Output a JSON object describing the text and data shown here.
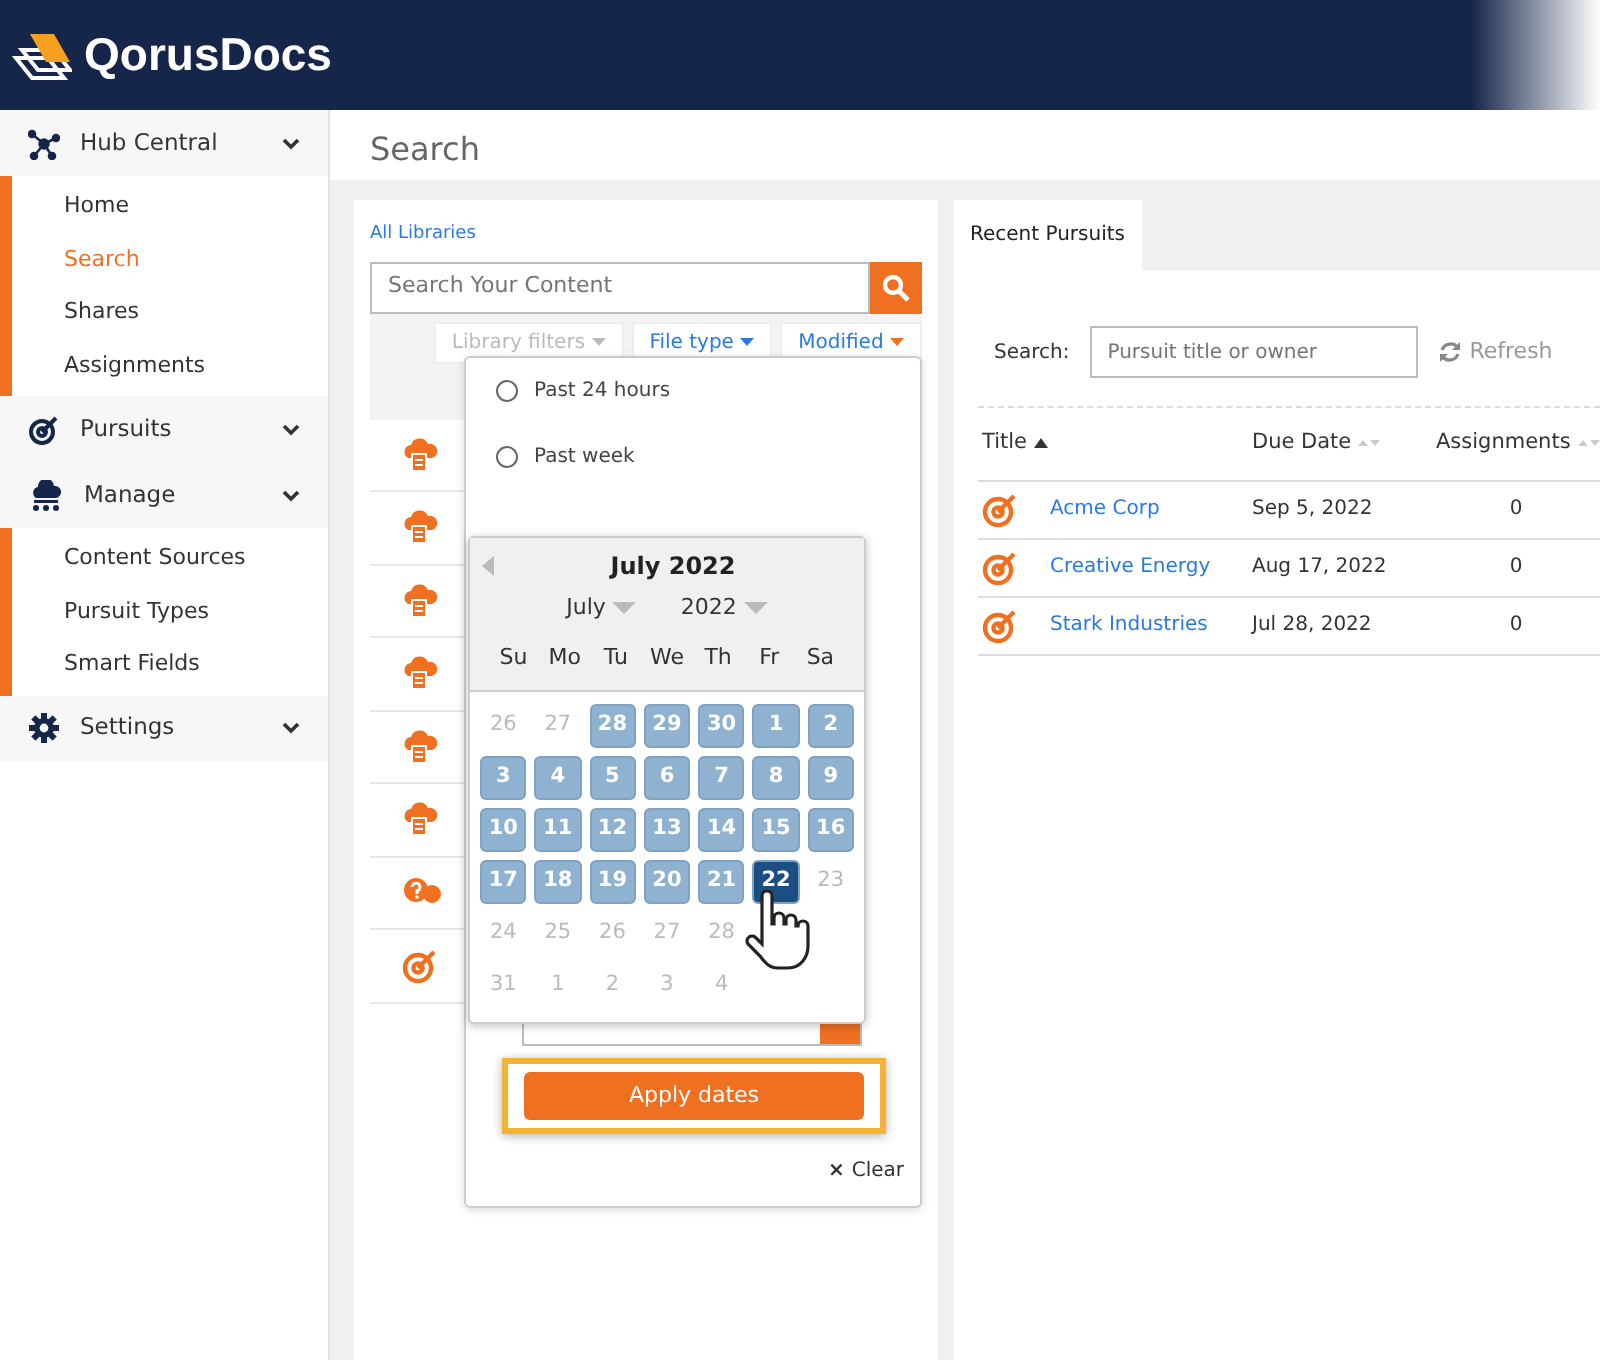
{
  "brand": {
    "name": "QorusDocs"
  },
  "sidebar": {
    "groups": [
      {
        "label": "Hub Central",
        "children": [
          {
            "label": "Home",
            "selected": false
          },
          {
            "label": "Search",
            "selected": true
          },
          {
            "label": "Shares",
            "selected": false
          },
          {
            "label": "Assignments",
            "selected": false
          }
        ]
      },
      {
        "label": "Pursuits"
      },
      {
        "label": "Manage",
        "children": [
          {
            "label": "Content Sources",
            "selected": false
          },
          {
            "label": "Pursuit Types",
            "selected": false
          },
          {
            "label": "Smart Fields",
            "selected": false
          }
        ]
      },
      {
        "label": "Settings"
      }
    ]
  },
  "page_title": "Search",
  "search_panel": {
    "library_link": "All Libraries",
    "search": {
      "placeholder": "Search Your Content"
    },
    "filters": [
      {
        "label": "Library filters",
        "disabled": true,
        "selected": false
      },
      {
        "label": "File type",
        "disabled": false,
        "selected": false
      },
      {
        "label": "Modified",
        "disabled": false,
        "selected": true
      }
    ],
    "results": [
      {
        "kind": "cloud"
      },
      {
        "kind": "cloud"
      },
      {
        "kind": "cloud"
      },
      {
        "kind": "cloud"
      },
      {
        "kind": "cloud"
      },
      {
        "kind": "cloud"
      },
      {
        "kind": "chat"
      },
      {
        "kind": "target"
      }
    ],
    "date_menu": {
      "options": [
        {
          "label": "Past 24 hours",
          "selected": false
        },
        {
          "label": "Past week",
          "selected": false
        }
      ],
      "apply_button": "Apply dates",
      "clear_button": "Clear",
      "clear_icon": "×"
    },
    "calendar": {
      "title": "July 2022",
      "month": "July",
      "year": "2022",
      "weekdays": [
        "Su",
        "Mo",
        "Tu",
        "We",
        "Th",
        "Fr",
        "Sa"
      ],
      "weeks": [
        [
          {
            "day": "26",
            "kind": "other",
            "selected": false
          },
          {
            "day": "27",
            "kind": "other",
            "selected": false
          },
          {
            "day": "28",
            "kind": "range",
            "selected": false
          },
          {
            "day": "29",
            "kind": "range",
            "selected": false
          },
          {
            "day": "30",
            "kind": "range",
            "selected": false
          },
          {
            "day": "1",
            "kind": "range",
            "selected": false
          },
          {
            "day": "2",
            "kind": "range",
            "selected": false
          }
        ],
        [
          {
            "day": "3",
            "kind": "range",
            "selected": false
          },
          {
            "day": "4",
            "kind": "range",
            "selected": false
          },
          {
            "day": "5",
            "kind": "range",
            "selected": false
          },
          {
            "day": "6",
            "kind": "range",
            "selected": false
          },
          {
            "day": "7",
            "kind": "range",
            "selected": false
          },
          {
            "day": "8",
            "kind": "range",
            "selected": false
          },
          {
            "day": "9",
            "kind": "range",
            "selected": false
          }
        ],
        [
          {
            "day": "10",
            "kind": "range",
            "selected": false
          },
          {
            "day": "11",
            "kind": "range",
            "selected": false
          },
          {
            "day": "12",
            "kind": "range",
            "selected": false
          },
          {
            "day": "13",
            "kind": "range",
            "selected": false
          },
          {
            "day": "14",
            "kind": "range",
            "selected": false
          },
          {
            "day": "15",
            "kind": "range",
            "selected": false
          },
          {
            "day": "16",
            "kind": "range",
            "selected": false
          }
        ],
        [
          {
            "day": "17",
            "kind": "range",
            "selected": false
          },
          {
            "day": "18",
            "kind": "range",
            "selected": false
          },
          {
            "day": "19",
            "kind": "range",
            "selected": false
          },
          {
            "day": "20",
            "kind": "range",
            "selected": false
          },
          {
            "day": "21",
            "kind": "range",
            "selected": false
          },
          {
            "day": "22",
            "kind": "range",
            "selected": true
          },
          {
            "day": "23",
            "kind": "other",
            "selected": false
          }
        ],
        [
          {
            "day": "24",
            "kind": "other",
            "selected": false
          },
          {
            "day": "25",
            "kind": "other",
            "selected": false
          },
          {
            "day": "26",
            "kind": "other",
            "selected": false
          },
          {
            "day": "27",
            "kind": "other",
            "selected": false
          },
          {
            "day": "28",
            "kind": "other",
            "selected": false
          }
        ],
        [
          {
            "day": "31",
            "kind": "other",
            "selected": false
          },
          {
            "day": "1",
            "kind": "other",
            "selected": false
          },
          {
            "day": "2",
            "kind": "other",
            "selected": false
          },
          {
            "day": "3",
            "kind": "other",
            "selected": false
          },
          {
            "day": "4",
            "kind": "other",
            "selected": false
          }
        ]
      ]
    }
  },
  "pursuits_panel": {
    "tab": {
      "label": "Recent Pursuits",
      "selected": true
    },
    "search_label": "Search:",
    "search": {
      "placeholder": "Pursuit title or owner"
    },
    "refresh_button": "Refresh",
    "columns": [
      {
        "label": "Title",
        "sorted": true
      },
      {
        "label": "Due Date",
        "sorted": false
      },
      {
        "label": "Assignments",
        "sorted": false
      }
    ],
    "rows": [
      {
        "title": "Acme Corp",
        "due": "Sep 5, 2022",
        "assignments": "0"
      },
      {
        "title": "Creative Energy",
        "due": "Aug 17, 2022",
        "assignments": "0"
      },
      {
        "title": "Stark Industries",
        "due": "Jul 28, 2022",
        "assignments": "0"
      }
    ]
  }
}
